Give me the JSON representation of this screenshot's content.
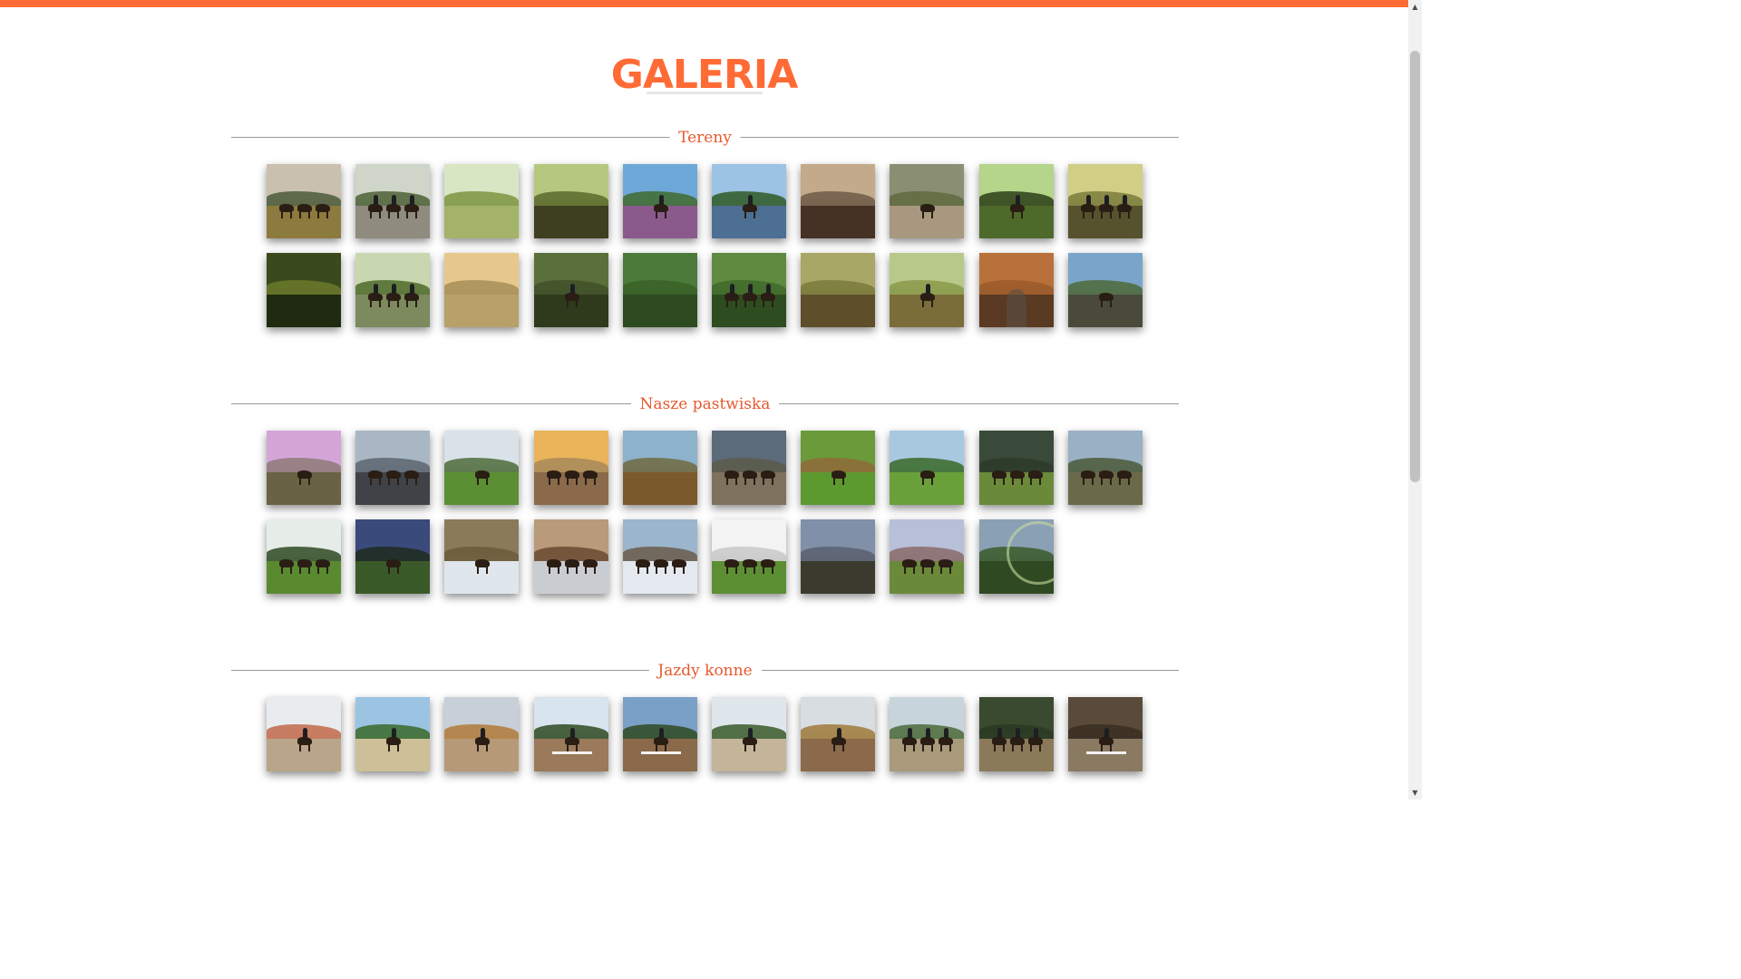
{
  "page": {
    "title": "GALERIA",
    "accent_color": "#ff6b35"
  },
  "sections": [
    {
      "label": "Tereny",
      "photos": [
        {
          "icon": "photo-icon",
          "sky": "#c9c1ae",
          "ground": "#8d7a3e",
          "hill": "#4b5a3a",
          "subject": "horses"
        },
        {
          "icon": "photo-icon",
          "sky": "#cfd6c9",
          "ground": "#8f8b7f",
          "hill": "#4e6136",
          "subject": "riders"
        },
        {
          "icon": "photo-icon",
          "sky": "#d8e6c4",
          "ground": "#a4b36a",
          "hill": "#7c9440",
          "subject": "forest"
        },
        {
          "icon": "photo-icon",
          "sky": "#b6c77f",
          "ground": "#3d3f20",
          "hill": "#5a6a2c",
          "subject": "forest"
        },
        {
          "icon": "photo-icon",
          "sky": "#6ea8d8",
          "ground": "#8a5a8c",
          "hill": "#3f6b2d",
          "subject": "rider"
        },
        {
          "icon": "photo-icon",
          "sky": "#9cc2e4",
          "ground": "#4d6f94",
          "hill": "#2f5a25",
          "subject": "rider"
        },
        {
          "icon": "photo-icon",
          "sky": "#c3aa8a",
          "ground": "#463225",
          "hill": "#6e5a48",
          "subject": "horizon"
        },
        {
          "icon": "photo-icon",
          "sky": "#8a8f74",
          "ground": "#a8987f",
          "hill": "#5f6a3e",
          "subject": "horse"
        },
        {
          "icon": "photo-icon",
          "sky": "#b4d58a",
          "ground": "#4e6a2a",
          "hill": "#2c3f17",
          "subject": "rider"
        },
        {
          "icon": "photo-icon",
          "sky": "#d1cf85",
          "ground": "#55522d",
          "hill": "#7b7b3c",
          "subject": "riders"
        },
        {
          "icon": "photo-icon",
          "sky": "#3a4a1c",
          "ground": "#1f2a10",
          "hill": "#6b7a2a",
          "subject": "forest"
        },
        {
          "icon": "photo-icon",
          "sky": "#c9d7b0",
          "ground": "#7c8a5e",
          "hill": "#4f6b2b",
          "subject": "riders"
        },
        {
          "icon": "photo-icon",
          "sky": "#e7c88c",
          "ground": "#b7a169",
          "hill": "#a68e58",
          "subject": "field"
        },
        {
          "icon": "photo-icon",
          "sky": "#5a6f3a",
          "ground": "#2f3a1c",
          "hill": "#41512a",
          "subject": "rider"
        },
        {
          "icon": "photo-icon",
          "sky": "#4c7a3a",
          "ground": "#2d4a20",
          "hill": "#3b6228",
          "subject": "forest"
        },
        {
          "icon": "photo-icon",
          "sky": "#5f8a3f",
          "ground": "#2d4d20",
          "hill": "#3f6a2a",
          "subject": "riders"
        },
        {
          "icon": "photo-icon",
          "sky": "#a9a766",
          "ground": "#5e4f2a",
          "hill": "#7a7a3c",
          "subject": "forest"
        },
        {
          "icon": "photo-icon",
          "sky": "#b7c88a",
          "ground": "#7a6d3a",
          "hill": "#8a9a4a",
          "subject": "rider"
        },
        {
          "icon": "photo-icon",
          "sky": "#b8713a",
          "ground": "#5a3a22",
          "hill": "#9a5a2a",
          "subject": "path"
        },
        {
          "icon": "photo-icon",
          "sky": "#7aa4c9",
          "ground": "#4a4a3a",
          "hill": "#4f6a3a",
          "subject": "horse"
        }
      ]
    },
    {
      "label": "Nasze pastwiska",
      "photos": [
        {
          "icon": "photo-icon",
          "sky": "#d4a6d8",
          "ground": "#6a6244",
          "hill": "#8f7a7a",
          "subject": "horse"
        },
        {
          "icon": "photo-icon",
          "sky": "#a9b7c4",
          "ground": "#3f4348",
          "hill": "#5d6670",
          "subject": "horses"
        },
        {
          "icon": "photo-icon",
          "sky": "#d9e2e8",
          "ground": "#5a8f33",
          "hill": "#4e6b3a",
          "subject": "horse"
        },
        {
          "icon": "photo-icon",
          "sky": "#e9b45a",
          "ground": "#8a6a4a",
          "hill": "#a88a5a",
          "subject": "horses"
        },
        {
          "icon": "photo-icon",
          "sky": "#8db2cc",
          "ground": "#7a5a2a",
          "hill": "#6e6a3e",
          "subject": "landscape"
        },
        {
          "icon": "photo-icon",
          "sky": "#5c6b7a",
          "ground": "#7e725f",
          "hill": "#5a5a4a",
          "subject": "horses"
        },
        {
          "icon": "photo-icon",
          "sky": "#6a9a3a",
          "ground": "#5c9a30",
          "hill": "#8f6a3a",
          "subject": "horse"
        },
        {
          "icon": "photo-icon",
          "sky": "#a8c8e0",
          "ground": "#6aa03a",
          "hill": "#3a6a28",
          "subject": "horse"
        },
        {
          "icon": "photo-icon",
          "sky": "#3a4a3a",
          "ground": "#6a8a3a",
          "hill": "#2d3a2a",
          "subject": "horses"
        },
        {
          "icon": "photo-icon",
          "sky": "#9ab0c4",
          "ground": "#6a6a4a",
          "hill": "#4a5a3a",
          "subject": "horses"
        },
        {
          "icon": "photo-icon",
          "sky": "#e6ece8",
          "ground": "#5a8a30",
          "hill": "#2e4a22",
          "subject": "horses"
        },
        {
          "icon": "photo-icon",
          "sky": "#3a4a7a",
          "ground": "#3a5a2a",
          "hill": "#1f2a1f",
          "subject": "horse"
        },
        {
          "icon": "photo-icon",
          "sky": "#8a7a5a",
          "ground": "#dfe6ec",
          "hill": "#6a5a3a",
          "subject": "horse"
        },
        {
          "icon": "photo-icon",
          "sky": "#b99a7a",
          "ground": "#c9cdd2",
          "hill": "#6a4a30",
          "subject": "horses"
        },
        {
          "icon": "photo-icon",
          "sky": "#9ab5cc",
          "ground": "#e3e9ee",
          "hill": "#6a5a4a",
          "subject": "horses"
        },
        {
          "icon": "photo-icon",
          "sky": "#f3f3f3",
          "ground": "#5c8f34",
          "hill": "#c8c8c8",
          "subject": "horses"
        },
        {
          "icon": "photo-icon",
          "sky": "#7f90a8",
          "ground": "#3a3a2e",
          "hill": "#5a6070",
          "subject": "horizon"
        },
        {
          "icon": "photo-icon",
          "sky": "#b8c0d8",
          "ground": "#6a8a3a",
          "hill": "#8a6a6a",
          "subject": "horses"
        },
        {
          "icon": "photo-icon",
          "sky": "#8aa0b4",
          "ground": "#2f4a22",
          "hill": "#3a5a2a",
          "subject": "rainbow"
        }
      ]
    },
    {
      "label": "Jazdy konne",
      "photos": [
        {
          "icon": "photo-icon",
          "sky": "#e8ecef",
          "ground": "#b9a58a",
          "hill": "#c26a4a",
          "subject": "rider"
        },
        {
          "icon": "photo-icon",
          "sky": "#9bc4e2",
          "ground": "#cdbf98",
          "hill": "#3a6a2a",
          "subject": "rider"
        },
        {
          "icon": "photo-icon",
          "sky": "#c7d0d8",
          "ground": "#b69a78",
          "hill": "#b07a3a",
          "subject": "rider"
        },
        {
          "icon": "photo-icon",
          "sky": "#d8e4ee",
          "ground": "#9a7a5a",
          "hill": "#2e4a22",
          "subject": "jump"
        },
        {
          "icon": "photo-icon",
          "sky": "#7aa0c8",
          "ground": "#8a6a4a",
          "hill": "#2f4a22",
          "subject": "jump"
        },
        {
          "icon": "photo-icon",
          "sky": "#dfe6ec",
          "ground": "#c4b49a",
          "hill": "#3a5a2a",
          "subject": "rider"
        },
        {
          "icon": "photo-icon",
          "sky": "#d8dde2",
          "ground": "#8a6a4a",
          "hill": "#a07a3a",
          "subject": "rider"
        },
        {
          "icon": "photo-icon",
          "sky": "#c8d4dc",
          "ground": "#a89a7a",
          "hill": "#4a6a3a",
          "subject": "riders"
        },
        {
          "icon": "photo-icon",
          "sky": "#3a4a2e",
          "ground": "#8a7a5a",
          "hill": "#2a3a22",
          "subject": "riders"
        },
        {
          "icon": "photo-icon",
          "sky": "#5a4a3a",
          "ground": "#8a7a62",
          "hill": "#3a2e22",
          "subject": "jump"
        }
      ]
    }
  ],
  "scrollbar": {
    "up_arrow": "▲",
    "down_arrow": "▼"
  }
}
